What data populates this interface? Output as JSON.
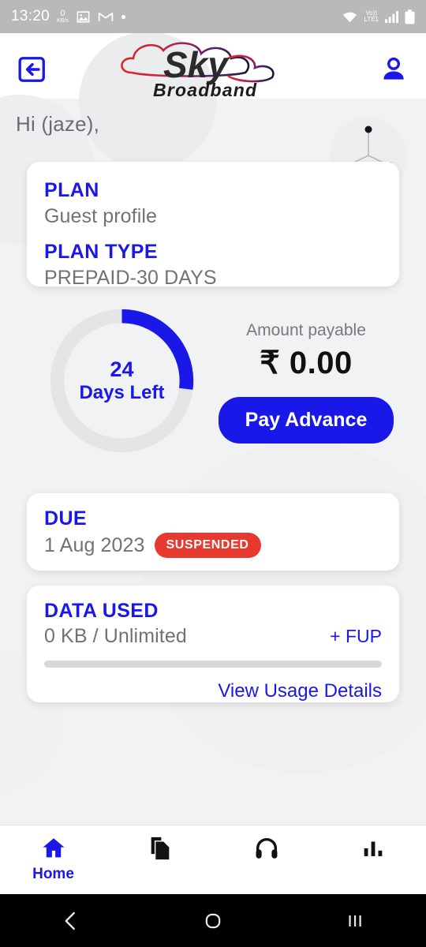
{
  "statusbar": {
    "time": "13:20",
    "netspeed_value": "0",
    "netspeed_unit": "KB/s",
    "icons": [
      "photos-icon",
      "gmail-icon",
      "dot-icon",
      "wifi-icon",
      "volte-icon",
      "signal-icon",
      "battery-icon"
    ],
    "volte_top": "Vo))",
    "volte_bottom": "LTE1",
    "background": "#b9b9b9"
  },
  "header": {
    "logout_icon": "logout-icon",
    "profile_icon": "account-icon",
    "logo": {
      "name": "sky-broadband-logo",
      "primary_text": "Sky",
      "secondary_text": "Broadband"
    }
  },
  "greeting": "Hi (jaze),",
  "plan_card": {
    "plan_label": "PLAN",
    "plan_value": "Guest profile",
    "plan_type_label": "PLAN TYPE",
    "plan_type_value": "PREPAID-30 DAYS"
  },
  "gauge": {
    "days": "24",
    "subtitle": "Days Left",
    "percent": 27,
    "arc_color": "#1a18e8",
    "track_color": "#e4e5e7"
  },
  "payment": {
    "amount_label": "Amount payable",
    "amount_value": "₹ 0.00",
    "pay_button": "Pay Advance",
    "button_color": "#1a18e8"
  },
  "due_card": {
    "label": "DUE",
    "date": "1 Aug 2023",
    "badge": "SUSPENDED",
    "badge_color": "#e8392e"
  },
  "data_card": {
    "label": "DATA USED",
    "usage": "0 KB / Unlimited",
    "fup_link": "+ FUP",
    "progress_percent": 0,
    "usage_link": "View Usage Details"
  },
  "bottom_nav": {
    "items": [
      {
        "label": "Home",
        "icon": "home-icon",
        "active": true
      },
      {
        "label": "",
        "icon": "documents-icon",
        "active": false
      },
      {
        "label": "",
        "icon": "headset-icon",
        "active": false
      },
      {
        "label": "",
        "icon": "bar-chart-icon",
        "active": false
      }
    ],
    "active_color": "#1a18e8"
  },
  "android_nav": {
    "back": "back-icon",
    "home": "home-circle-icon",
    "recents": "recents-icon"
  },
  "theme": {
    "accent_blue": "#1a18e8",
    "text_gray": "#6f7377",
    "page_bg": "#f1f2f4"
  }
}
